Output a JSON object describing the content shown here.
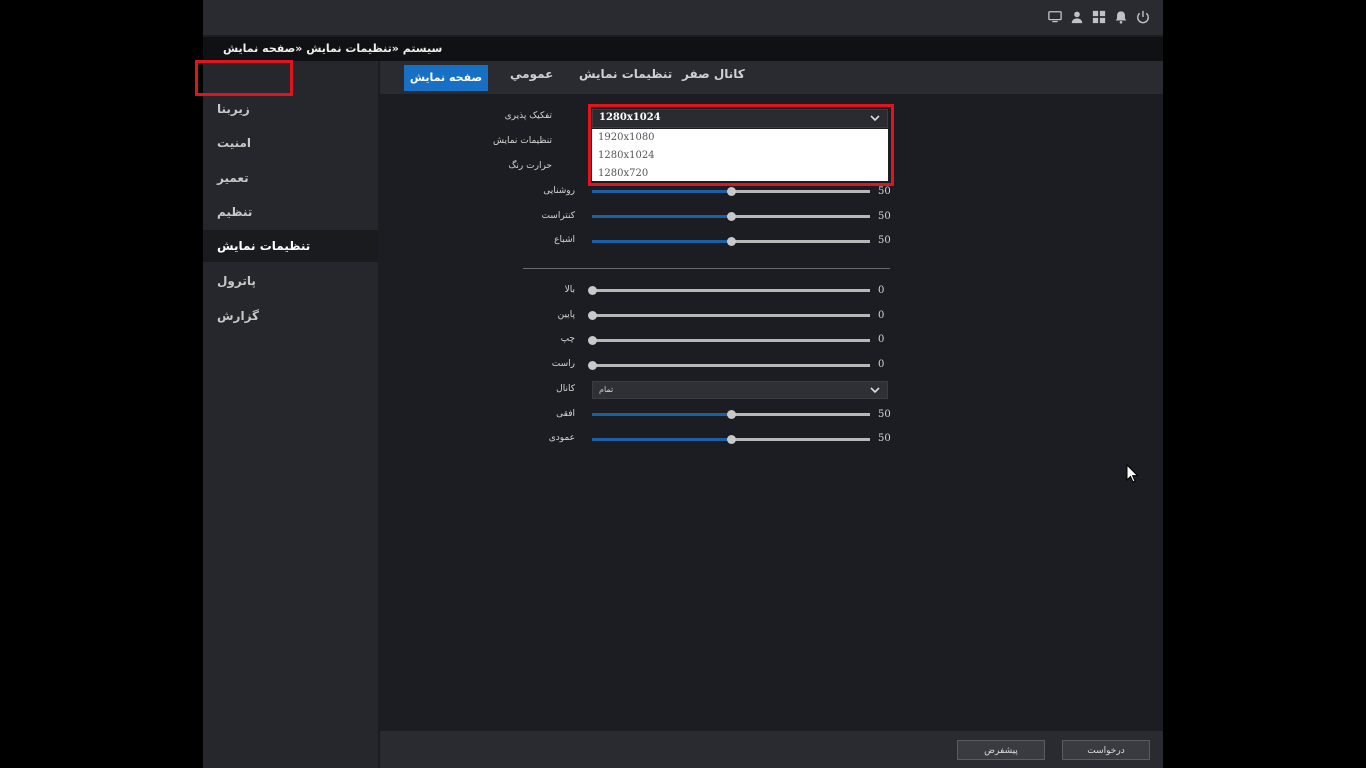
{
  "breadcrumb": "سیستم  «تنظیمات نمایش  «صفحه نمایش",
  "topbar_icons": [
    "monitor-icon",
    "user-icon",
    "grid-icon",
    "bell-icon",
    "power-icon"
  ],
  "sidebar": {
    "items": [
      {
        "label": "زیربنا"
      },
      {
        "label": "امنیت"
      },
      {
        "label": "تعمیر"
      },
      {
        "label": "تنظیم"
      },
      {
        "label": "تنظیمات نمایش",
        "active": true
      },
      {
        "label": "پاترول"
      },
      {
        "label": "گزارش"
      }
    ]
  },
  "tabs": [
    {
      "label": "صفحه نمایش",
      "active": true
    },
    {
      "label": "عمومي"
    },
    {
      "label": "تنظیمات نمایش"
    },
    {
      "label": "کانال صفر"
    }
  ],
  "form": {
    "resolution": {
      "label": "تفکیک پذیری",
      "value": "1280x1024",
      "options": [
        "1920x1080",
        "1280x1024",
        "1280x720"
      ]
    },
    "display_settings_label": "تنظیمات نمایش",
    "color_temp_label": "حرارت رنگ",
    "image_sliders": [
      {
        "label": "روشنایی",
        "value": "50",
        "fraction": 0.5
      },
      {
        "label": "کنتراست",
        "value": "50",
        "fraction": 0.5
      },
      {
        "label": "اشباع",
        "value": "50",
        "fraction": 0.5
      }
    ],
    "edge_sliders": [
      {
        "label": "بالا",
        "value": "0",
        "fraction": 0
      },
      {
        "label": "پایین",
        "value": "0",
        "fraction": 0
      },
      {
        "label": "چپ",
        "value": "0",
        "fraction": 0
      },
      {
        "label": "راست",
        "value": "0",
        "fraction": 0
      }
    ],
    "channel": {
      "label": "کانال",
      "value": "تمام"
    },
    "position_sliders": [
      {
        "label": "افقی",
        "value": "50",
        "fraction": 0.5
      },
      {
        "label": "عمودی",
        "value": "50",
        "fraction": 0.5
      }
    ]
  },
  "buttons": {
    "default": "پیشفرض",
    "apply": "درخواست"
  },
  "colors": {
    "accent": "#1770c4",
    "highlight": "#e0141e",
    "slider_fill": "#1b5fa6"
  }
}
